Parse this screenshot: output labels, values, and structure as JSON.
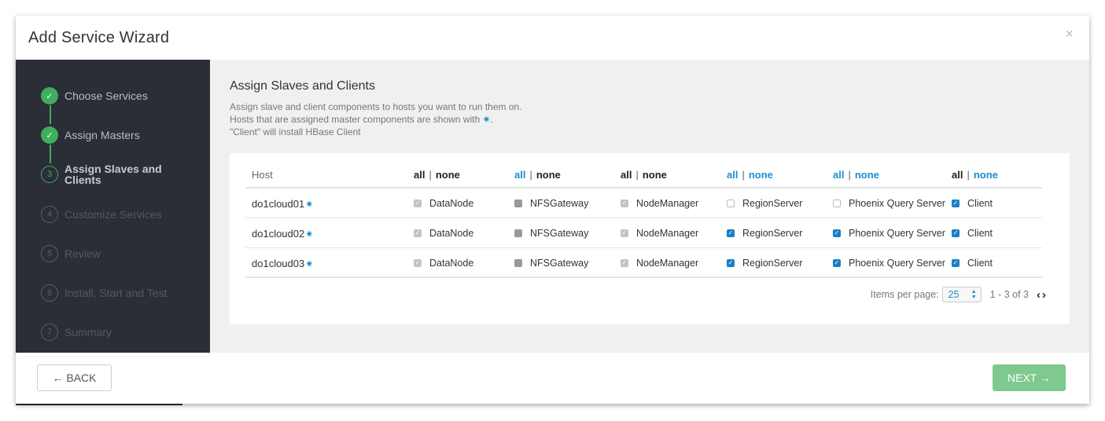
{
  "modal": {
    "title": "Add Service Wizard",
    "close_glyph": "×"
  },
  "sidebar": {
    "steps": [
      {
        "marker": "✓",
        "label": "Choose Services",
        "state": "done"
      },
      {
        "marker": "✓",
        "label": "Assign Masters",
        "state": "done"
      },
      {
        "marker": "3",
        "label": "Assign Slaves and Clients",
        "state": "current"
      },
      {
        "marker": "4",
        "label": "Customize Services",
        "state": "future"
      },
      {
        "marker": "5",
        "label": "Review",
        "state": "future"
      },
      {
        "marker": "6",
        "label": "Install, Start and Test",
        "state": "future"
      },
      {
        "marker": "7",
        "label": "Summary",
        "state": "future"
      }
    ]
  },
  "main": {
    "title": "Assign Slaves and Clients",
    "description": {
      "line1": "Assign slave and client components to hosts you want to run them on.",
      "line2": "Hosts that are assigned master components are shown with",
      "line2_star": "✷",
      "line2_end": ".",
      "line3": "\"Client\" will install HBase Client"
    },
    "table": {
      "host_header": "Host",
      "all_label": "all",
      "none_label": "none",
      "separator": "|",
      "master_star": "✷",
      "rows": [
        {
          "host": "do1cloud01",
          "cells": [
            "DataNode",
            "NFSGateway",
            "NodeManager",
            "RegionServer",
            "Phoenix Query Server",
            "Client"
          ]
        },
        {
          "host": "do1cloud02",
          "cells": [
            "DataNode",
            "NFSGateway",
            "NodeManager",
            "RegionServer",
            "Phoenix Query Server",
            "Client"
          ]
        },
        {
          "host": "do1cloud03",
          "cells": [
            "DataNode",
            "NFSGateway",
            "NodeManager",
            "RegionServer",
            "Phoenix Query Server",
            "Client"
          ]
        }
      ],
      "checked_glyph": "✓"
    },
    "pagination": {
      "items_per_page_label": "Items per page:",
      "items_per_page_value": "25",
      "range": "1 - 3 of 3",
      "prev_glyph": "‹",
      "next_glyph": "›"
    }
  },
  "footer": {
    "back_label": "← BACK",
    "next_label": "NEXT →"
  },
  "colors": {
    "accent_blue": "#1b8ed1",
    "success_green": "#3fae5d",
    "next_disabled_green": "#7dc98e",
    "sidebar_bg": "#2b2d37"
  }
}
